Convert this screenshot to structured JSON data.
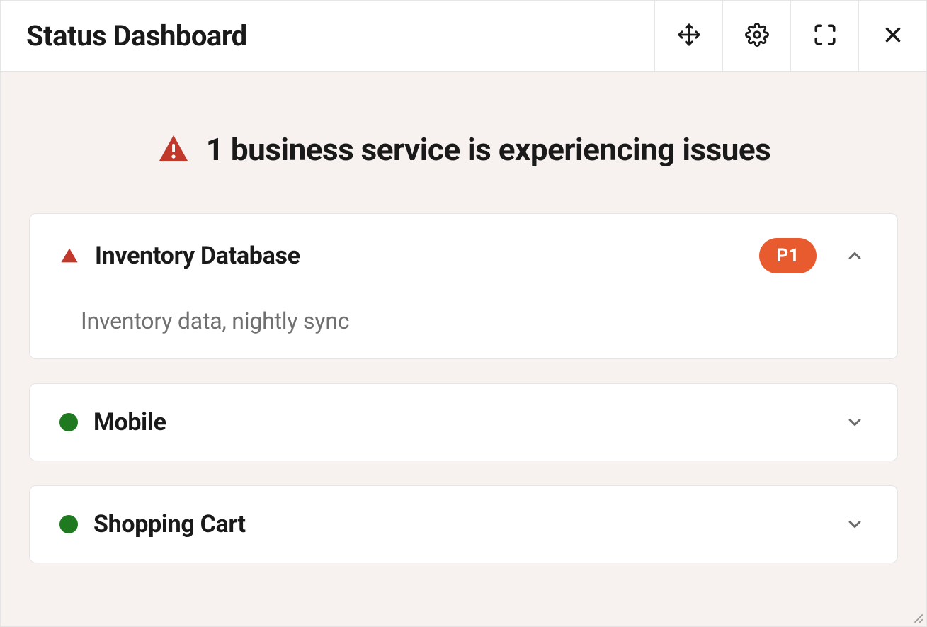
{
  "header": {
    "title": "Status Dashboard"
  },
  "banner": {
    "text": "1 business service is experiencing issues"
  },
  "services": [
    {
      "status": "alert",
      "name": "Inventory Database",
      "priority": "P1",
      "expanded": true,
      "description": "Inventory data, nightly sync"
    },
    {
      "status": "ok",
      "name": "Mobile",
      "expanded": false
    },
    {
      "status": "ok",
      "name": "Shopping Cart",
      "expanded": false
    }
  ]
}
